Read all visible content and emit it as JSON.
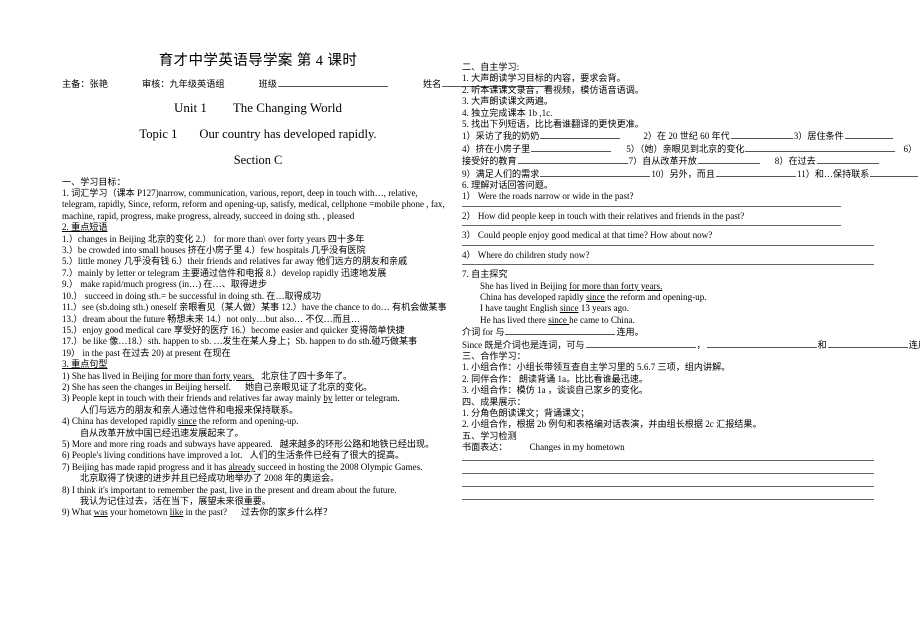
{
  "header": {
    "doc_title": "育才中学英语导学案  第 4 课时",
    "prepared_label": "主备：",
    "prepared_by": "张艳",
    "reviewed_label": "审核：",
    "reviewed_by": "九年级英语组",
    "class_label": "班级",
    "name_label": "姓名",
    "unit_label": "Unit 1",
    "unit_title": "The Changing World",
    "topic_label": "Topic 1",
    "topic_title": "Our country has developed rapidly.",
    "section": "Section C"
  },
  "left": {
    "sec1_title": "一、学习目标：",
    "vocab_heading": "1. 词汇学习（课本 P127)",
    "vocab_text": "narrow, communication, various, report, deep in touch with…, relative, telegram, rapidly, Since, reform, reform and opening-up, satisfy, medical,   cellphone =mobile phone , fax, machine, rapid, progress, make progress, already, succeed in doing sth. , pleased",
    "phrases_heading": "2. 重点短语",
    "phrases": [
      "1.）changes in Beijing   北京的变化       2.）  for more than\\ over forty years  四十多年",
      "3.）be crowded into small houses  挤在小房子里      4.）few hospitals         几乎没有医院",
      "5.）little money  几乎没有钱     6.）their friends and relatives far away    他们远方的朋友和亲戚",
      "7.）mainly by letter or telegram  主要通过信件和电报      8.）develop rapidly     迅速地发展",
      "9.）  make rapid/much progress (in…)    在…、取得进步",
      "10.）   succeed in doing sth.= be successful in doing sth.    在…取得成功",
      "11.）see (sb.doing sth.) oneself  亲眼看见（某人做）某事 12.）have the chance to do…   有机会做某事",
      "13.）dream about the future     畅想未来     14.）not only…but also…      不仅…而且…",
      "15.）enjoy good medical care   享受好的医疗   16.）become easier and quicker 变得简单快捷",
      "17.）be like        像…18.）sth. happen to sb.   …发生在某人身上；Sb. happen to do sth.碰巧做某事",
      "19）  in the past    在过去     20) at present      在现在"
    ],
    "sentences_heading": "3. 重点句型",
    "sentences": [
      {
        "en": "1) She has lived in Beijing for more than forty years.",
        "underline": "for more than forty years.",
        "cn": "北京住了四十多年了。",
        "inline": true
      },
      {
        "en": "2) She has seen the changes in Beijing herself.",
        "cn": "她自己亲眼见证了北京的变化。",
        "inline": true
      },
      {
        "en": "3) People kept in touch with their friends and relatives far away mainly by letter or telegram.",
        "underline": "by",
        "cn": "人们与远方的朋友和亲人通过信件和电报来保持联系。",
        "inline": false
      },
      {
        "en": "4) China has developed rapidly since the reform and opening-up.",
        "underline": "since",
        "cn": "自从改革开放中国已经迅速发展起来了。",
        "inline": false
      },
      {
        "en": "5) More and more ring roads and subways have appeared.",
        "cn": "越来越多的环形公路和地铁已经出现。",
        "inline": true
      },
      {
        "en": "6) People's living conditions have improved a lot.",
        "cn": "人们的生活条件已经有了很大的提高。",
        "inline": true
      },
      {
        "en": "7) Beijing has made rapid progress and it has already succeed in hosting the 2008 Olympic Games.",
        "underline": "already",
        "cn": "北京取得了快速的进步并且已经成功地举办了 2008 年的奥运会。",
        "inline": false
      },
      {
        "en": "8) I think it's important to remember the past, live in the present and dream about the future.",
        "cn": "我认为记住过去，活在当下，展望未来很重要。",
        "inline": false
      },
      {
        "en": "9) What was your hometown like in the past?",
        "underline": "was",
        "cn": "过去你的家乡什么样？",
        "inline": true
      }
    ]
  },
  "right": {
    "sec2_title": "二、自主学习:",
    "steps": [
      "1. 大声朗读学习目标的内容，要求会背。",
      "2. 听本课课文录音，看视频，模仿语音语调。",
      "3. 大声朗读课文两遍。",
      "4. 独立完成课本 1b ,1c.",
      "5. 找出下列短语，比比看谁翻译的更快更准。"
    ],
    "translate_items": [
      "1）采访了我的奶奶",
      "2）在 20 世纪 60 年代",
      "3）居住条件",
      "4）挤在小房子里",
      "5）（她）亲眼见到北京的变化",
      "6）接受好的教育",
      "7）自从改革开放",
      "8）在过去",
      "9）满足人们的需求",
      "10）另外，而且",
      "11）和…保持联系"
    ],
    "q_heading": "6. 理解对话回答问题。",
    "questions": [
      "1） Were the roads narrow or wide in the past?",
      "2） How did people keep in touch with their relatives and friends in the past?",
      "3） Could people enjoy good medical at that time? How about now?",
      "4） Where do children study now?"
    ],
    "explore_heading": "7. 自主探究",
    "examples": [
      {
        "text": "She has lived in Beijing for more than forty years.",
        "underline": "for more than forty years."
      },
      {
        "text": "China has developed rapidly since the reform and opening-up.",
        "underline": "since"
      },
      {
        "text": "I have taught English since 13 years ago.",
        "underline": "since"
      },
      {
        "text": "He has lived there since he came to China.",
        "underline": "since "
      }
    ],
    "rule1_a": "介词 for 与",
    "rule1_b": "连用。",
    "rule2_a": "Since 既是介词也是连词，可与",
    "rule2_b": "，",
    "rule2_c": "和",
    "rule2_d": "连用。",
    "sec3_title": "三、合作学习：",
    "coop": [
      "1. 小组合作：小组长带领互查自主学习里的 5.6.7 三项，组内讲解。",
      "2. 同伴合作：  朗读背诵 1a。比比看谁最迅速。",
      "3. 小组合作：模仿 1a ，谈谈自己家乡的变化。"
    ],
    "sec4_title": "四、成果展示：",
    "show": [
      "1. 分角色朗读课文；背诵课文；",
      "2. 小组合作，根据 2b 例句和表格编对话表演，并由组长根据 2c 汇报结果。"
    ],
    "sec5_title": "五、学习检测",
    "writing_label": "书面表达：",
    "writing_topic": "Changes in my hometown",
    "blank_line_count": 4
  }
}
